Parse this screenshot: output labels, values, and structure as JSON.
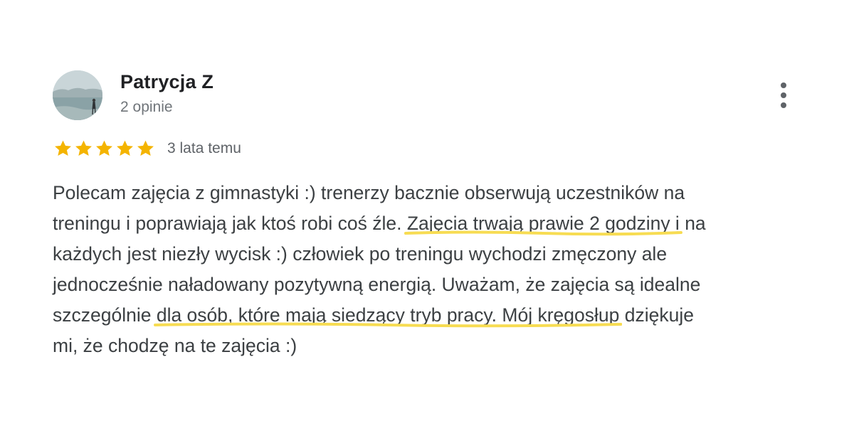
{
  "review": {
    "reviewer_name": "Patrycja Z",
    "review_count": "2 opinie",
    "rating": 5,
    "rating_max": 5,
    "date": "3 lata temu",
    "text_lines": [
      "Polecam zajęcia z gimnastyki :) trenerzy bacznie obserwują uczestników na",
      "treningu i poprawiają jak ktoś robi coś źle. Zajęcia trwają prawie 2 godziny i na",
      "każdych jest niezły wycisk :) człowiek po treningu wychodzi zmęczony ale",
      "jednocześnie naładowany pozytywną energią. Uważam, że zajęcia są idealne",
      "szczególnie dla osób, które mają siedzący tryb pracy. Mój kręgosłup dziękuje",
      "mi, że chodzę na te zajęcia :)"
    ],
    "highlights": [
      "Zajęcia trwają prawie 2 godziny i",
      "dla osób, które mają siedzący tryb pracy. Mój kręgosłup"
    ]
  },
  "icons": {
    "star": "star-icon",
    "more": "more-vert-icon"
  },
  "colors": {
    "star": "#f4b400",
    "highlight_underline": "#f7dc52",
    "name": "#202124",
    "secondary": "#70757a",
    "body_text": "#3c4043"
  }
}
